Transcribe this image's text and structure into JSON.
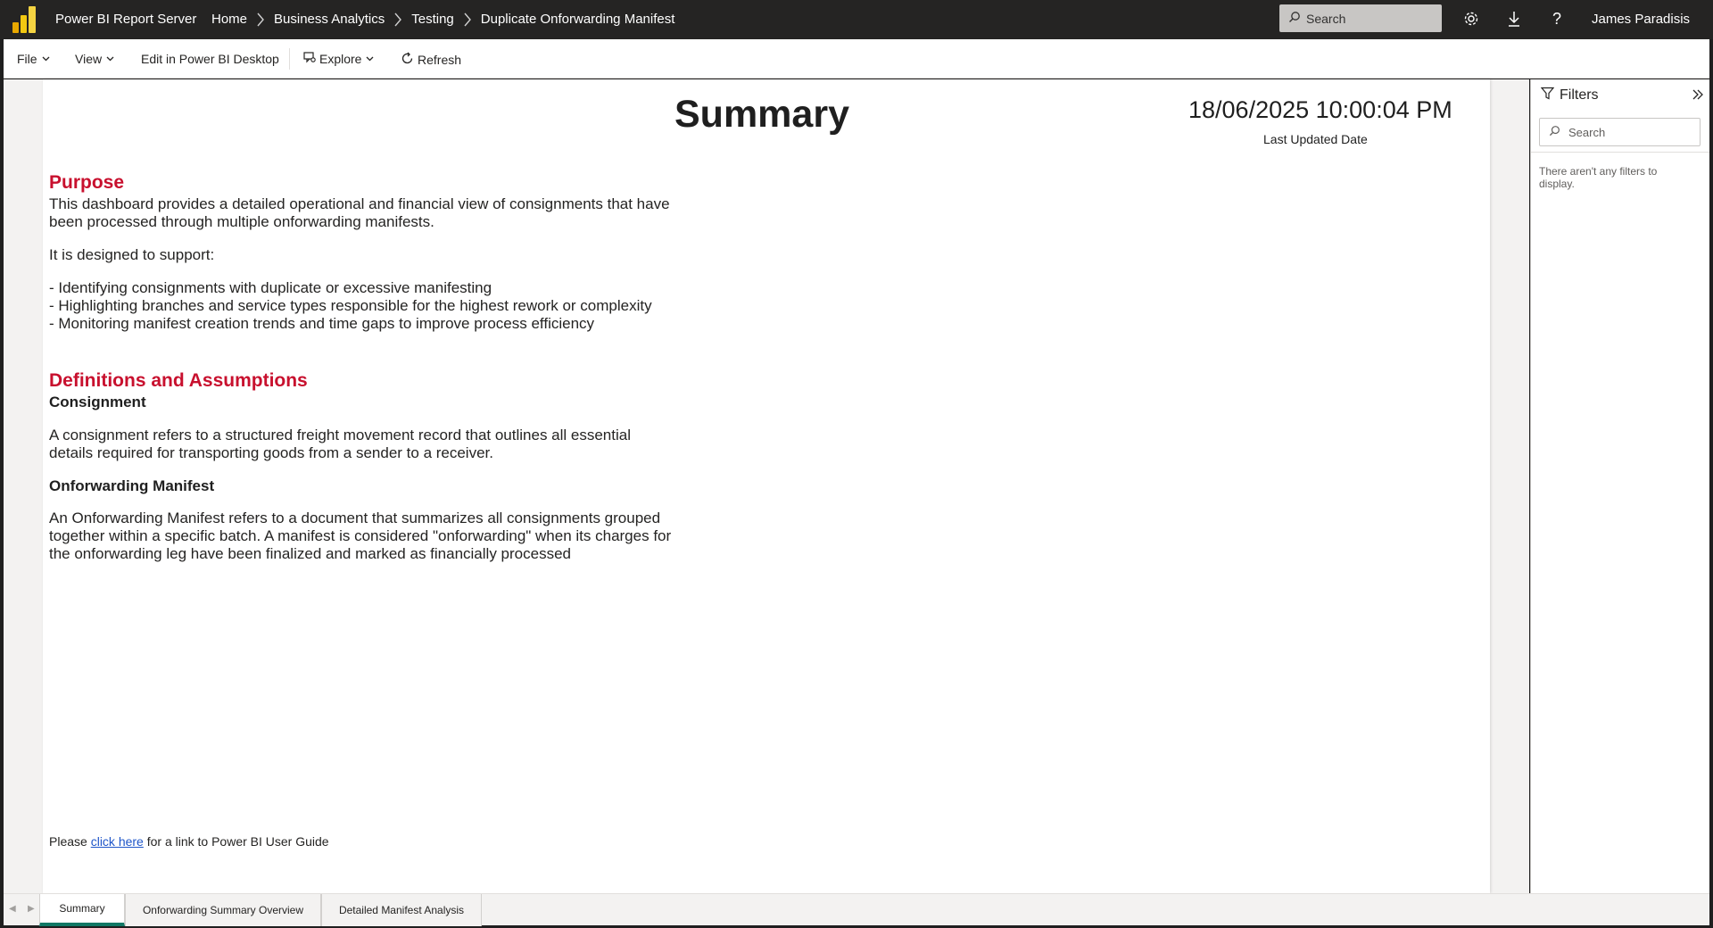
{
  "header": {
    "app_title": "Power BI Report Server",
    "breadcrumbs": [
      {
        "label": "Home"
      },
      {
        "label": "Business Analytics"
      },
      {
        "label": "Testing"
      },
      {
        "label": "Duplicate Onforwarding Manifest"
      }
    ],
    "search_placeholder": "Search",
    "user_name": "James Paradisis",
    "icons": [
      "gear-icon",
      "download-icon",
      "help-icon"
    ]
  },
  "toolbar": {
    "file_label": "File",
    "view_label": "View",
    "edit_label": "Edit in Power BI Desktop",
    "explore_label": "Explore",
    "refresh_label": "Refresh"
  },
  "report": {
    "title": "Summary",
    "last_updated_value": "18/06/2025 10:00:04 PM",
    "last_updated_label": "Last Updated Date",
    "purpose_heading": "Purpose",
    "purpose_lines": [
      "This dashboard provides a detailed operational and financial view of consignments that have",
      "been processed through multiple onforwarding manifests."
    ],
    "support_intro": "It is designed to support:",
    "support_items": [
      "- Identifying consignments with duplicate or excessive manifesting",
      "- Highlighting branches and service types responsible for the highest rework or complexity",
      "- Monitoring manifest creation trends and time gaps to improve process efficiency"
    ],
    "definitions_heading": "Definitions and Assumptions",
    "consignment_heading": "Consignment",
    "consignment_lines": [
      "A consignment refers to a structured freight movement record that outlines all essential",
      "details required for transporting goods from a sender to a receiver."
    ],
    "manifest_heading": "Onforwarding Manifest",
    "manifest_lines": [
      "An Onforwarding Manifest refers to a document that summarizes all consignments grouped",
      "together within a specific batch. A manifest is considered \"onforwarding\" when its charges for",
      "the onforwarding leg have been finalized and marked as financially processed"
    ],
    "footer_prefix": "Please ",
    "footer_link": "click here",
    "footer_suffix": " for a link to Power BI User Guide"
  },
  "filters": {
    "title": "Filters",
    "search_placeholder": "Search",
    "empty_message": "There aren't any filters to display."
  },
  "tabs": [
    {
      "label": "Summary",
      "active": true
    },
    {
      "label": "Onforwarding Summary Overview",
      "active": false
    },
    {
      "label": "Detailed Manifest Analysis",
      "active": false
    }
  ],
  "colors": {
    "topbar": "#252423",
    "heading_red": "#c8102e",
    "active_tab_accent": "#117865",
    "link": "#1f56c9"
  }
}
